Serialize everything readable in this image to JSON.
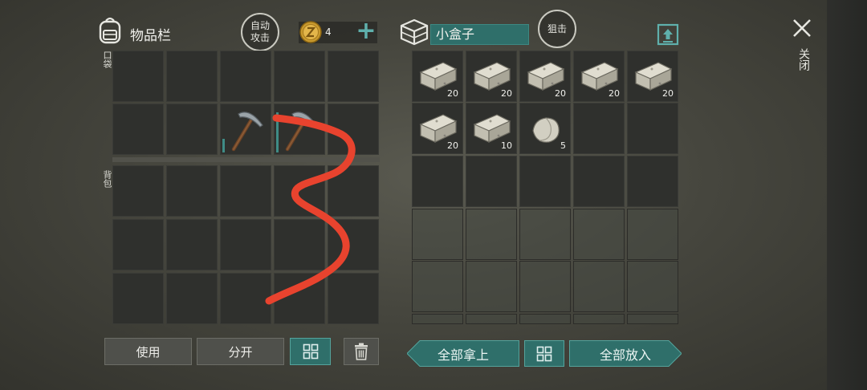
{
  "header": {
    "inventory_title": "物品栏",
    "auto_attack_line1": "自动",
    "auto_attack_line2": "攻击",
    "coins": "4",
    "container_name": "小盒子",
    "snipe_label": "狙击",
    "close_label": "关闭"
  },
  "inventory": {
    "pocket_label": "口袋",
    "backpack_label": "背包",
    "pocket_slots": [
      {
        "item": null
      },
      {
        "item": null
      },
      {
        "item": null
      },
      {
        "item": null
      },
      {
        "item": null
      },
      {
        "item": null
      },
      {
        "item": null
      },
      {
        "item": "pickaxe-icon",
        "durability": 0.3
      },
      {
        "item": "pickaxe-icon",
        "durability": 0.9
      },
      {
        "item": null
      }
    ],
    "backpack_rows": 3,
    "backpack_cols": 5
  },
  "container": {
    "slots": [
      {
        "item": "stone-brick-icon",
        "qty": "20"
      },
      {
        "item": "stone-brick-icon",
        "qty": "20"
      },
      {
        "item": "stone-brick-icon",
        "qty": "20"
      },
      {
        "item": "stone-brick-icon",
        "qty": "20"
      },
      {
        "item": "stone-brick-icon",
        "qty": "20"
      },
      {
        "item": "stone-brick-icon",
        "qty": "20"
      },
      {
        "item": "stone-brick-icon",
        "qty": "10"
      },
      {
        "item": "stone-icon",
        "qty": "5"
      }
    ],
    "rows": 6,
    "cols": 5
  },
  "buttons": {
    "use": "使用",
    "split": "分开",
    "take_all": "全部拿上",
    "put_all": "全部放入"
  },
  "colors": {
    "accent_teal": "#2f6f6a",
    "scribble_red": "#e8432e"
  }
}
